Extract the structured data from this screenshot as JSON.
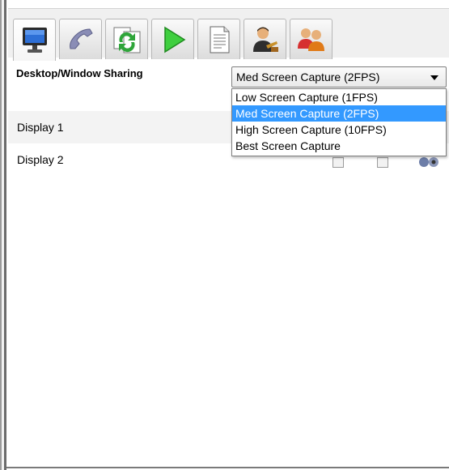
{
  "tabs": [
    {
      "id": "desktop",
      "icon": "monitor-icon",
      "active": true
    },
    {
      "id": "phone",
      "icon": "phone-icon",
      "active": false
    },
    {
      "id": "sync",
      "icon": "sync-icon",
      "active": false
    },
    {
      "id": "play",
      "icon": "play-icon",
      "active": false
    },
    {
      "id": "document",
      "icon": "document-icon",
      "active": false
    },
    {
      "id": "presenter",
      "icon": "presenter-icon",
      "active": false
    },
    {
      "id": "users",
      "icon": "users-icon",
      "active": false
    }
  ],
  "section": {
    "title": "Desktop/Window Sharing"
  },
  "capture": {
    "selected": "Med Screen Capture (2FPS)",
    "options": [
      "Low Screen Capture (1FPS)",
      "Med Screen Capture (2FPS)",
      "High Screen Capture (10FPS)",
      "Best Screen Capture"
    ],
    "highlighted_index": 1,
    "highlight_color": "#3399ff"
  },
  "displays": [
    {
      "label": "Display 1"
    },
    {
      "label": "Display 2"
    }
  ]
}
